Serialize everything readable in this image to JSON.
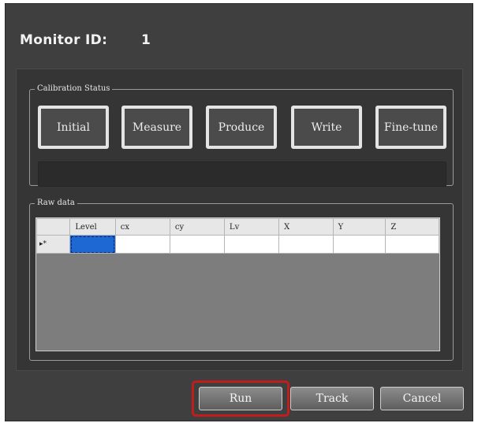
{
  "header": {
    "label": "Monitor ID:",
    "value": "1"
  },
  "calibration": {
    "legend": "Calibration Status",
    "steps": [
      "Initial",
      "Measure",
      "Produce",
      "Write",
      "Fine-tune"
    ],
    "progress": 0
  },
  "raw_data": {
    "legend": "Raw data",
    "columns": [
      "Level",
      "cx",
      "cy",
      "Lv",
      "X",
      "Y",
      "Z"
    ],
    "row_marker": "▸*",
    "rows": [
      [
        "",
        "",
        "",
        "",
        "",
        "",
        ""
      ]
    ]
  },
  "footer": {
    "run": "Run",
    "track": "Track",
    "cancel": "Cancel"
  },
  "colors": {
    "highlight": "#c01d1d",
    "selected_cell": "#1e68d4"
  }
}
